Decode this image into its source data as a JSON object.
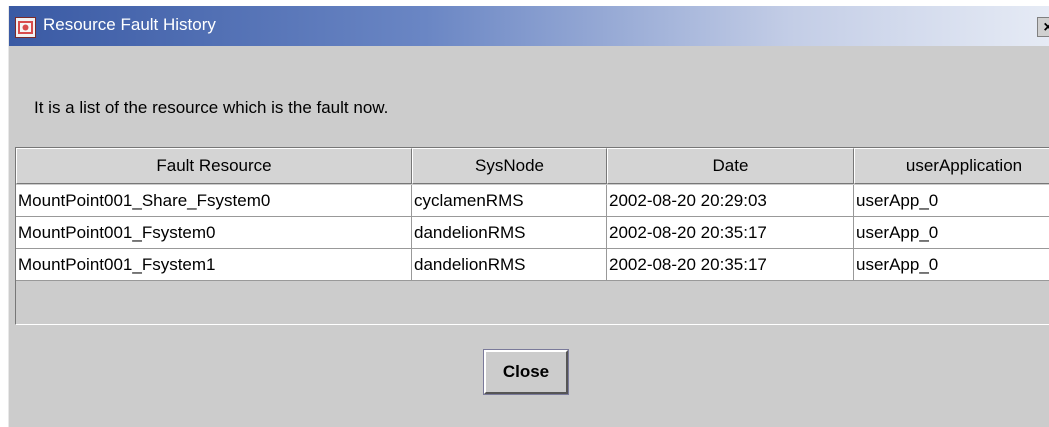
{
  "window": {
    "title": "Resource Fault History",
    "close_glyph": "×",
    "icon": "app-icon"
  },
  "message": "It is a list of the resource which is the fault now.",
  "table": {
    "columns": [
      "Fault Resource",
      "SysNode",
      "Date",
      "userApplication"
    ],
    "rows": [
      [
        "MountPoint001_Share_Fsystem0",
        "cyclamenRMS",
        "2002-08-20 20:29:03",
        "userApp_0"
      ],
      [
        "MountPoint001_Fsystem0",
        "dandelionRMS",
        "2002-08-20 20:35:17",
        "userApp_0"
      ],
      [
        "MountPoint001_Fsystem1",
        "dandelionRMS",
        "2002-08-20 20:35:17",
        "userApp_0"
      ]
    ]
  },
  "buttons": {
    "close_label": "Close"
  }
}
